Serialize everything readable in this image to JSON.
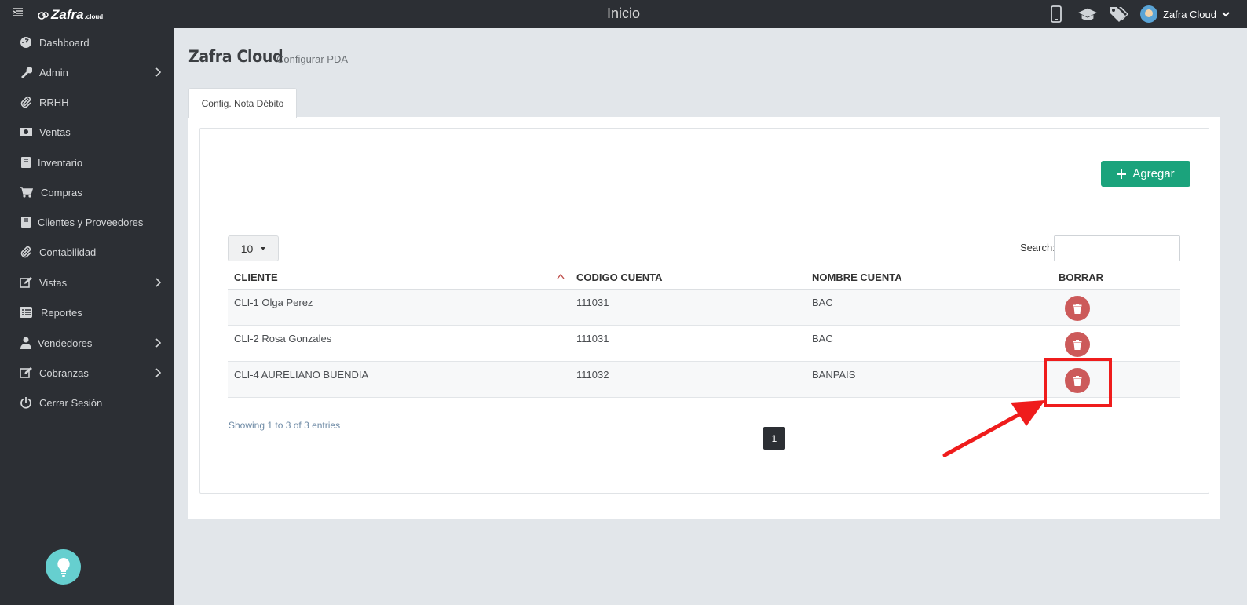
{
  "header": {
    "title": "Inicio",
    "logo_text": "Zafra",
    "logo_suffix": ".cloud",
    "user_name": "Zafra Cloud"
  },
  "sidebar": {
    "items": [
      {
        "label": "Dashboard",
        "icon": "dashboard-icon"
      },
      {
        "label": "Admin",
        "icon": "wrench-icon",
        "has_submenu": true
      },
      {
        "label": "RRHH",
        "icon": "paperclip-icon"
      },
      {
        "label": "Ventas",
        "icon": "money-icon"
      },
      {
        "label": "Inventario",
        "icon": "book-icon"
      },
      {
        "label": "Compras",
        "icon": "cart-icon"
      },
      {
        "label": "Clientes y Proveedores",
        "icon": "book-icon"
      },
      {
        "label": "Contabilidad",
        "icon": "paperclip-icon"
      },
      {
        "label": "Vistas",
        "icon": "edit-icon",
        "has_submenu": true
      },
      {
        "label": "Reportes",
        "icon": "list-icon"
      },
      {
        "label": "Vendedores",
        "icon": "user-icon",
        "has_submenu": true
      },
      {
        "label": "Cobranzas",
        "icon": "edit-icon",
        "has_submenu": true
      },
      {
        "label": "Cerrar Sesión",
        "icon": "power-icon"
      }
    ]
  },
  "page": {
    "title": "Zafra Cloud",
    "subtitle": "Configurar PDA",
    "tab_label": "Config. Nota Débito",
    "add_button_label": "Agregar"
  },
  "table": {
    "page_length": "10",
    "search_label": "Search:",
    "search_value": "",
    "columns": [
      "CLIENTE",
      "CODIGO CUENTA",
      "NOMBRE CUENTA",
      "BORRAR"
    ],
    "rows": [
      {
        "cliente": "CLI-1 Olga Perez",
        "codigo_cuenta": "111031",
        "nombre_cuenta": "BAC"
      },
      {
        "cliente": "CLI-2 Rosa Gonzales",
        "codigo_cuenta": "111031",
        "nombre_cuenta": "BAC"
      },
      {
        "cliente": "CLI-4 AURELIANO BUENDIA",
        "codigo_cuenta": "111032",
        "nombre_cuenta": "BANPAIS"
      }
    ],
    "info": "Showing 1 to 3 of 3 entries",
    "current_page": "1"
  },
  "colors": {
    "sidebar_bg": "#2c2f34",
    "accent_green": "#1ba37c",
    "delete_red": "#cc5a5a",
    "annotation_red": "#ef1c1c"
  }
}
